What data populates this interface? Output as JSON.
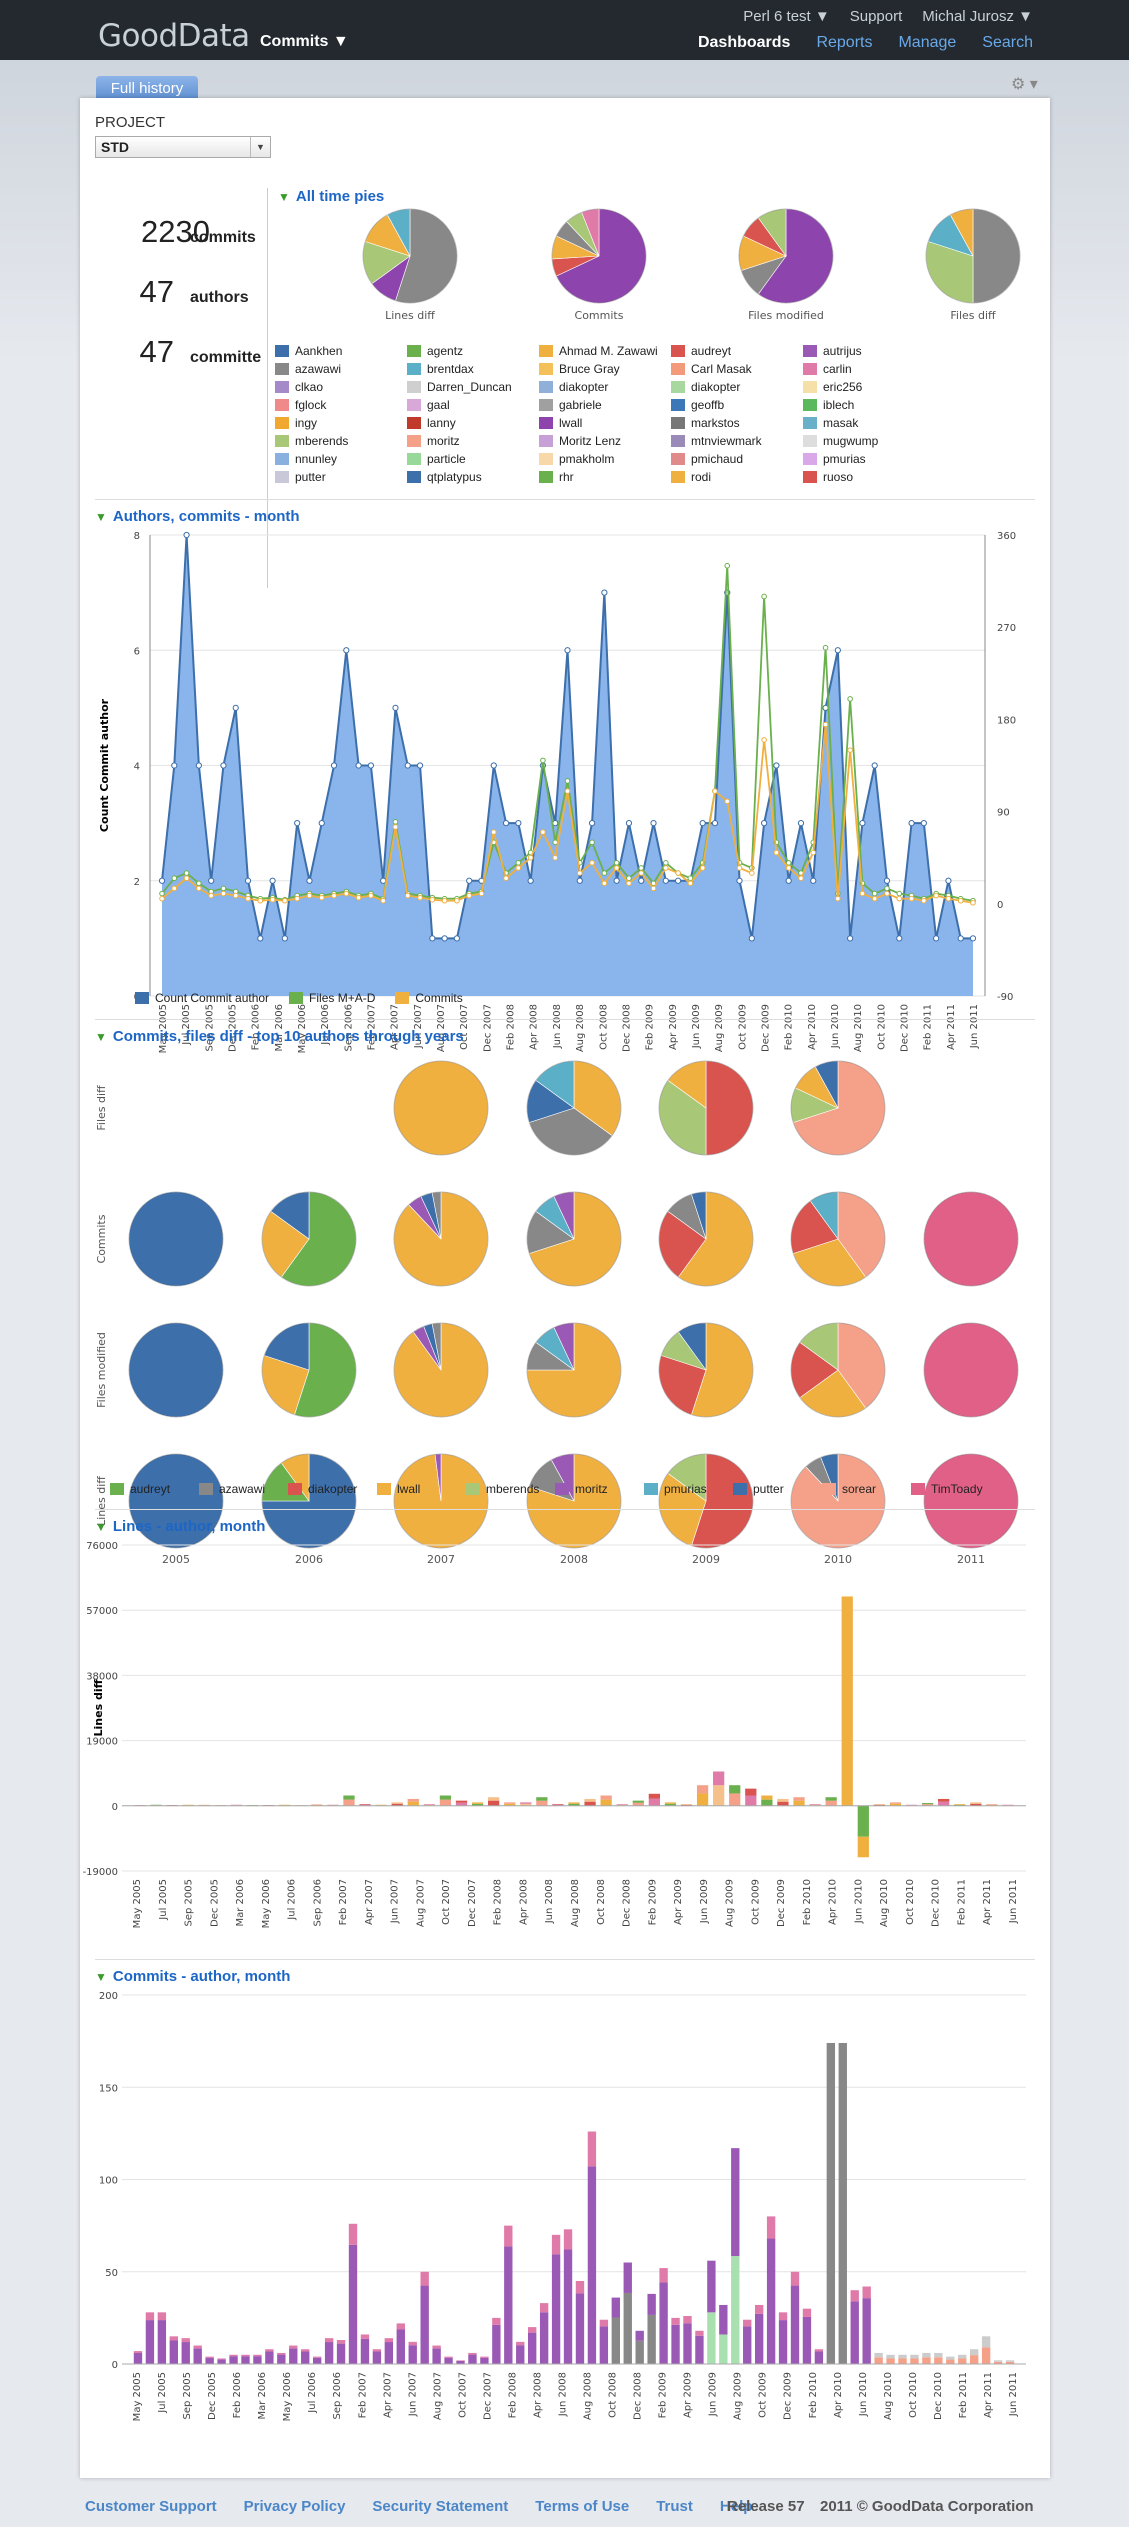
{
  "header": {
    "logo": "GoodData",
    "project_selector": "Commits ▼",
    "project_menu": "Perl 6 test ▼",
    "support": "Support",
    "user": "Michal Jurosz ▼",
    "nav": [
      "Dashboards",
      "Reports",
      "Manage",
      "Search"
    ]
  },
  "tab": "Full history",
  "gear_icon": "gear-icon",
  "project": {
    "label": "PROJECT",
    "value": "STD"
  },
  "kpis": [
    {
      "value": "2230",
      "label": "commits"
    },
    {
      "value": "47",
      "label": "authors"
    },
    {
      "value": "47",
      "label": "committe"
    }
  ],
  "pies_section": {
    "title": "All time pies",
    "pies": [
      "Lines diff",
      "Commits",
      "Files modified",
      "Files diff"
    ],
    "legend": [
      [
        "Aankhen",
        "#3d6fab"
      ],
      [
        "agentz",
        "#6ab04c"
      ],
      [
        "Ahmad M. Zawawi",
        "#f0b040"
      ],
      [
        "audreyt",
        "#d9534f"
      ],
      [
        "autrijus",
        "#9b59b6"
      ],
      [
        "azawawi",
        "#888888"
      ],
      [
        "brentdax",
        "#5bb0c8"
      ],
      [
        "Bruce Gray",
        "#f3c05a"
      ],
      [
        "Carl Masak",
        "#f39a7a"
      ],
      [
        "carlin",
        "#e07aa8"
      ],
      [
        "clkao",
        "#a48ac8"
      ],
      [
        "Darren_Duncan",
        "#cfcfcf"
      ],
      [
        "diakopter",
        "#8fb0d8"
      ],
      [
        "diakopter",
        "#a8d8a0"
      ],
      [
        "eric256",
        "#f5e0a8"
      ],
      [
        "fglock",
        "#f08a8a"
      ],
      [
        "gaal",
        "#d8a8d8"
      ],
      [
        "gabriele",
        "#a0a0a0"
      ],
      [
        "geoffb",
        "#3c78b8"
      ],
      [
        "iblech",
        "#5cb85c"
      ],
      [
        "ingy",
        "#f0a830"
      ],
      [
        "lanny",
        "#c0392b"
      ],
      [
        "lwall",
        "#8e44ad"
      ],
      [
        "markstos",
        "#777777"
      ],
      [
        "masak",
        "#6ab0c8"
      ],
      [
        "mberends",
        "#a8c878"
      ],
      [
        "moritz",
        "#f5a088"
      ],
      [
        "Moritz Lenz",
        "#c8a0d8"
      ],
      [
        "mtnviewmark",
        "#9a8ab8"
      ],
      [
        "mugwump",
        "#dddddd"
      ],
      [
        "nnunley",
        "#8ab0e0"
      ],
      [
        "particle",
        "#98d898"
      ],
      [
        "pmakholm",
        "#f8d8a8"
      ],
      [
        "pmichaud",
        "#e08a8a"
      ],
      [
        "pmurias",
        "#d8a8e8"
      ],
      [
        "putter",
        "#c8c8d8"
      ],
      [
        "qtplatypus",
        "#3d6fab"
      ],
      [
        "rhr",
        "#6ab04c"
      ],
      [
        "rodi",
        "#f0b040"
      ],
      [
        "ruoso",
        "#d9534f"
      ]
    ]
  },
  "authors_month": {
    "title": "Authors, commits - month",
    "ylabel": "Count Commit author",
    "legend": [
      "Count Commit author",
      "Files M+A-D",
      "Commits"
    ]
  },
  "top10_section": {
    "title": "Commits, files diff - top 10 authors through years",
    "rows": [
      "Files diff",
      "Commits",
      "Files modified",
      "Lines diff"
    ],
    "years": [
      "2005",
      "2006",
      "2007",
      "2008",
      "2009",
      "2010",
      "2011"
    ],
    "legend": [
      [
        "audreyt",
        "#6ab04c"
      ],
      [
        "azawawi",
        "#888888"
      ],
      [
        "diakopter",
        "#d9534f"
      ],
      [
        "lwall",
        "#f0b040"
      ],
      [
        "mberends",
        "#a8c878"
      ],
      [
        "moritz",
        "#9b59b6"
      ],
      [
        "pmurias",
        "#5bb0c8"
      ],
      [
        "putter",
        "#3d6fab"
      ],
      [
        "sorear",
        "#f5a088"
      ],
      [
        "TimToady",
        "#e06088"
      ]
    ]
  },
  "lines_section": {
    "title": "Lines - author, month",
    "ylabel": "Lines diff"
  },
  "commits_section": {
    "title": "Commits - author, month"
  },
  "month_labels": [
    "May 2005",
    "Jul 2005",
    "Sep 2005",
    "Dec 2005",
    "Feb 2006",
    "Mar 2006",
    "May 2006",
    "Jul 2006",
    "Sep 2006",
    "Feb 2007",
    "Apr 2007",
    "Jun 2007",
    "Aug 2007",
    "Oct 2007",
    "Dec 2007",
    "Feb 2008",
    "Apr 2008",
    "Jun 2008",
    "Aug 2008",
    "Oct 2008",
    "Dec 2008",
    "Feb 2009",
    "Apr 2009",
    "Jun 2009",
    "Aug 2009",
    "Oct 2009",
    "Dec 2009",
    "Feb 2010",
    "Apr 2010",
    "Jun 2010",
    "Aug 2010",
    "Oct 2010",
    "Dec 2010",
    "Feb 2011",
    "Apr 2011",
    "Jun 2011"
  ],
  "lines_month_labels": [
    "May 2005",
    "Jul 2005",
    "Sep 2005",
    "Dec 2005",
    "Mar 2006",
    "May 2006",
    "Jul 2006",
    "Sep 2006",
    "Feb 2007",
    "Apr 2007",
    "Jun 2007",
    "Aug 2007",
    "Oct 2007",
    "Dec 2007",
    "Feb 2008",
    "Apr 2008",
    "Jun 2008",
    "Aug 2008",
    "Oct 2008",
    "Dec 2008",
    "Feb 2009",
    "Apr 2009",
    "Jun 2009",
    "Aug 2009",
    "Oct 2009",
    "Dec 2009",
    "Feb 2010",
    "Apr 2010",
    "Jun 2010",
    "Aug 2010",
    "Oct 2010",
    "Dec 2010",
    "Feb 2011",
    "Apr 2011",
    "Jun 2011"
  ],
  "footer": {
    "links": [
      "Customer Support",
      "Privacy Policy",
      "Security Statement",
      "Terms of Use",
      "Trust",
      "Help"
    ],
    "release": "Release 57",
    "copyright": "2011 © GoodData Corporation"
  },
  "chart_data": [
    {
      "type": "line",
      "title": "Authors, commits - month",
      "ylabel": "Count Commit author",
      "ylim": [
        0,
        8
      ],
      "y2lim": [
        -90,
        360
      ],
      "y_ticks": [
        0,
        2,
        4,
        6,
        8
      ],
      "y2_ticks": [
        -90,
        0,
        90,
        180,
        270,
        360
      ],
      "series": [
        {
          "name": "Count Commit author",
          "axis": "left",
          "values": [
            2,
            4,
            8,
            4,
            2,
            4,
            5,
            2,
            1,
            2,
            1,
            3,
            2,
            3,
            4,
            6,
            4,
            4,
            2,
            5,
            4,
            4,
            1,
            1,
            1,
            2,
            2,
            4,
            3,
            3,
            2,
            4,
            3,
            6,
            2,
            3,
            7,
            2,
            3,
            2,
            3,
            2,
            2,
            2,
            3,
            3,
            7,
            2,
            1,
            3,
            4,
            2,
            3,
            2,
            5,
            6,
            1,
            3,
            4,
            2,
            1,
            3,
            3,
            1,
            2,
            1,
            1
          ]
        },
        {
          "name": "Files M+A-D",
          "axis": "right",
          "values": [
            10,
            25,
            30,
            20,
            12,
            15,
            12,
            8,
            5,
            6,
            4,
            8,
            10,
            8,
            10,
            12,
            8,
            10,
            5,
            80,
            10,
            8,
            6,
            5,
            5,
            10,
            12,
            60,
            30,
            40,
            50,
            140,
            60,
            120,
            40,
            60,
            30,
            40,
            25,
            35,
            20,
            40,
            30,
            25,
            40,
            110,
            330,
            40,
            35,
            300,
            60,
            40,
            30,
            60,
            250,
            10,
            200,
            20,
            10,
            15,
            10,
            8,
            5,
            10,
            8,
            5,
            3
          ]
        },
        {
          "name": "Commits",
          "axis": "right",
          "values": [
            5,
            15,
            25,
            15,
            8,
            10,
            8,
            5,
            3,
            4,
            3,
            5,
            8,
            6,
            8,
            10,
            6,
            8,
            3,
            75,
            8,
            6,
            4,
            3,
            3,
            8,
            10,
            70,
            25,
            35,
            45,
            70,
            45,
            110,
            30,
            40,
            20,
            35,
            20,
            30,
            15,
            35,
            30,
            20,
            35,
            110,
            100,
            35,
            30,
            160,
            50,
            35,
            25,
            50,
            175,
            5,
            150,
            10,
            5,
            10,
            5,
            5,
            3,
            8,
            5,
            3,
            1
          ]
        }
      ]
    },
    {
      "type": "pie",
      "title": "All time pies",
      "pies": [
        {
          "name": "Lines diff",
          "values": [
            55,
            10,
            15,
            12,
            8
          ],
          "colors": [
            "#888888",
            "#8e44ad",
            "#a8c878",
            "#f0b040",
            "#5bb0c8"
          ]
        },
        {
          "name": "Commits",
          "values": [
            68,
            6,
            8,
            6,
            6,
            6
          ],
          "colors": [
            "#8e44ad",
            "#d9534f",
            "#f0b040",
            "#888888",
            "#a8c878",
            "#e07aa8"
          ]
        },
        {
          "name": "Files modified",
          "values": [
            60,
            10,
            12,
            8,
            10
          ],
          "colors": [
            "#8e44ad",
            "#888888",
            "#f0b040",
            "#d9534f",
            "#a8c878"
          ]
        },
        {
          "name": "Files diff",
          "values": [
            50,
            30,
            12,
            8
          ],
          "colors": [
            "#888888",
            "#a8c878",
            "#5bb0c8",
            "#f0b040"
          ]
        }
      ]
    },
    {
      "type": "bar",
      "title": "Lines - author, month",
      "ylabel": "Lines diff",
      "ylim": [
        -19000,
        76000
      ],
      "y_ticks": [
        -19000,
        0,
        19000,
        38000,
        57000,
        76000
      ],
      "values": [
        200,
        300,
        200,
        300,
        300,
        200,
        300,
        200,
        200,
        300,
        200,
        400,
        300,
        3000,
        500,
        300,
        1000,
        2000,
        500,
        3000,
        1500,
        1000,
        2500,
        1000,
        1000,
        2500,
        500,
        1000,
        2000,
        3000,
        500,
        1500,
        3500,
        1000,
        500,
        6000,
        10000,
        6000,
        5000,
        3000,
        2000,
        2500,
        500,
        2500,
        61000,
        -15000,
        500,
        1000,
        300,
        800,
        2000,
        500,
        1000,
        500,
        300
      ]
    },
    {
      "type": "bar",
      "title": "Commits - author, month",
      "ylim": [
        0,
        200
      ],
      "y_ticks": [
        0,
        50,
        100,
        150,
        200
      ],
      "values": [
        7,
        28,
        28,
        15,
        14,
        10,
        4,
        3,
        5,
        5,
        5,
        8,
        6,
        10,
        8,
        4,
        14,
        13,
        76,
        16,
        8,
        14,
        22,
        12,
        50,
        10,
        4,
        2,
        6,
        4,
        25,
        75,
        12,
        20,
        33,
        70,
        73,
        45,
        126,
        24,
        36,
        55,
        18,
        38,
        52,
        25,
        26,
        18,
        56,
        32,
        117,
        24,
        32,
        80,
        28,
        50,
        30,
        8,
        174,
        174,
        40,
        42,
        6,
        5,
        5,
        5,
        6,
        6,
        4,
        5,
        8,
        15,
        2,
        2
      ]
    }
  ]
}
